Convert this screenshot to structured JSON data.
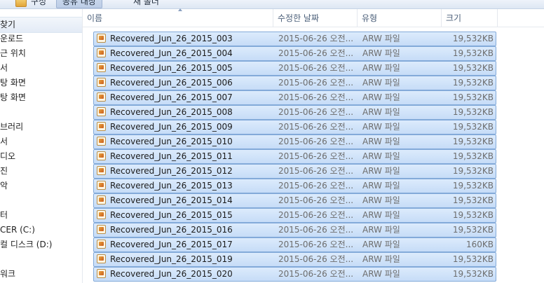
{
  "toolbar": {
    "organize_label": "구성",
    "share_label": "공유 대상",
    "new_folder_label": "새 폴더"
  },
  "nav": {
    "items": [
      {
        "label": "찾기",
        "selected": true
      },
      {
        "label": "운로드"
      },
      {
        "label": "근 위치"
      },
      {
        "label": "서"
      },
      {
        "label": "탕 화면"
      },
      {
        "label": "탕 화면"
      },
      {
        "label": ""
      },
      {
        "label": "브러리"
      },
      {
        "label": "서"
      },
      {
        "label": "디오"
      },
      {
        "label": "진"
      },
      {
        "label": "악"
      },
      {
        "label": ""
      },
      {
        "label": "터"
      },
      {
        "label": "CER (C:)"
      },
      {
        "label": "컬 디스크 (D:)"
      },
      {
        "label": ""
      },
      {
        "label": "워크"
      }
    ]
  },
  "columns": {
    "name": "이름",
    "date": "수정한 날짜",
    "type": "유형",
    "size": "크기"
  },
  "files": [
    {
      "name": "Recovered_Jun_26_2015_003",
      "date": "2015-06-26 오전...",
      "type": "ARW 파일",
      "size": "19,532KB"
    },
    {
      "name": "Recovered_Jun_26_2015_004",
      "date": "2015-06-26 오전...",
      "type": "ARW 파일",
      "size": "19,532KB"
    },
    {
      "name": "Recovered_Jun_26_2015_005",
      "date": "2015-06-26 오전...",
      "type": "ARW 파일",
      "size": "19,532KB"
    },
    {
      "name": "Recovered_Jun_26_2015_006",
      "date": "2015-06-26 오전...",
      "type": "ARW 파일",
      "size": "19,532KB"
    },
    {
      "name": "Recovered_Jun_26_2015_007",
      "date": "2015-06-26 오전...",
      "type": "ARW 파일",
      "size": "19,532KB"
    },
    {
      "name": "Recovered_Jun_26_2015_008",
      "date": "2015-06-26 오전...",
      "type": "ARW 파일",
      "size": "19,532KB"
    },
    {
      "name": "Recovered_Jun_26_2015_009",
      "date": "2015-06-26 오전...",
      "type": "ARW 파일",
      "size": "19,532KB"
    },
    {
      "name": "Recovered_Jun_26_2015_010",
      "date": "2015-06-26 오전...",
      "type": "ARW 파일",
      "size": "19,532KB"
    },
    {
      "name": "Recovered_Jun_26_2015_011",
      "date": "2015-06-26 오전...",
      "type": "ARW 파일",
      "size": "19,532KB"
    },
    {
      "name": "Recovered_Jun_26_2015_012",
      "date": "2015-06-26 오전...",
      "type": "ARW 파일",
      "size": "19,532KB"
    },
    {
      "name": "Recovered_Jun_26_2015_013",
      "date": "2015-06-26 오전...",
      "type": "ARW 파일",
      "size": "19,532KB"
    },
    {
      "name": "Recovered_Jun_26_2015_014",
      "date": "2015-06-26 오전...",
      "type": "ARW 파일",
      "size": "19,532KB"
    },
    {
      "name": "Recovered_Jun_26_2015_015",
      "date": "2015-06-26 오전...",
      "type": "ARW 파일",
      "size": "19,532KB"
    },
    {
      "name": "Recovered_Jun_26_2015_016",
      "date": "2015-06-26 오전...",
      "type": "ARW 파일",
      "size": "19,532KB"
    },
    {
      "name": "Recovered_Jun_26_2015_017",
      "date": "2015-06-26 오전...",
      "type": "ARW 파일",
      "size": "160KB"
    },
    {
      "name": "Recovered_Jun_26_2015_019",
      "date": "2015-06-26 오전...",
      "type": "ARW 파일",
      "size": "19,532KB"
    },
    {
      "name": "Recovered_Jun_26_2015_020",
      "date": "2015-06-26 오전...",
      "type": "ARW 파일",
      "size": "19,532KB"
    }
  ]
}
